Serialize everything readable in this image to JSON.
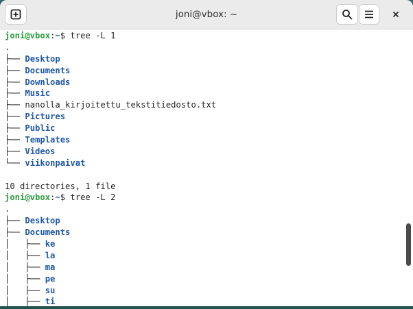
{
  "window": {
    "title": "joni@vbox: ~",
    "new_tab_icon": "new-tab-icon",
    "search_icon": "search-icon",
    "menu_icon": "hamburger-menu-icon",
    "close_icon": "close-icon"
  },
  "terminal": {
    "colors": {
      "user": "#2a9d3a",
      "path": "#2456b4",
      "dir": "#1f57a8",
      "text": "#222222"
    },
    "prompt1": {
      "user": "joni@vbox",
      "sep": ":",
      "path": "~",
      "suffix": "$ ",
      "command": "tree -L 1"
    },
    "root1": ".",
    "tree1": [
      {
        "prefix": "├── ",
        "name": "Desktop",
        "type": "dir"
      },
      {
        "prefix": "├── ",
        "name": "Documents",
        "type": "dir"
      },
      {
        "prefix": "├── ",
        "name": "Downloads",
        "type": "dir"
      },
      {
        "prefix": "├── ",
        "name": "Music",
        "type": "dir"
      },
      {
        "prefix": "├── ",
        "name": "nanolla_kirjoitettu_tekstitiedosto.txt",
        "type": "file"
      },
      {
        "prefix": "├── ",
        "name": "Pictures",
        "type": "dir"
      },
      {
        "prefix": "├── ",
        "name": "Public",
        "type": "dir"
      },
      {
        "prefix": "├── ",
        "name": "Templates",
        "type": "dir"
      },
      {
        "prefix": "├── ",
        "name": "Videos",
        "type": "dir"
      },
      {
        "prefix": "└── ",
        "name": "viikonpaivat",
        "type": "dir"
      }
    ],
    "summary1": "10 directories, 1 file",
    "prompt2": {
      "user": "joni@vbox",
      "sep": ":",
      "path": "~",
      "suffix": "$ ",
      "command": "tree -L 2"
    },
    "root2": ".",
    "tree2": [
      {
        "prefix": "├── ",
        "name": "Desktop",
        "type": "dir"
      },
      {
        "prefix": "├── ",
        "name": "Documents",
        "type": "dir"
      },
      {
        "prefix": "│   ├── ",
        "name": "ke",
        "type": "dir"
      },
      {
        "prefix": "│   ├── ",
        "name": "la",
        "type": "dir"
      },
      {
        "prefix": "│   ├── ",
        "name": "ma",
        "type": "dir"
      },
      {
        "prefix": "│   ├── ",
        "name": "pe",
        "type": "dir"
      },
      {
        "prefix": "│   ├── ",
        "name": "su",
        "type": "dir"
      },
      {
        "prefix": "│   ├── ",
        "name": "ti",
        "type": "dir"
      }
    ]
  }
}
